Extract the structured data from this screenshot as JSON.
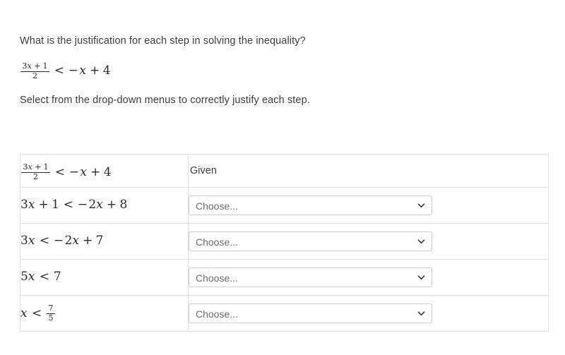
{
  "prompt": {
    "question": "What is the justification for each step in solving the inequality?",
    "inequality": {
      "fraction_numerator": "3x+1",
      "fraction_denominator": "2",
      "relation": "<",
      "right_side": "−x + 4"
    },
    "instruction": "Select from the drop-down menus to correctly justify each step."
  },
  "table": {
    "rows": [
      {
        "step_text": "(3x+1)/2 < −x + 4",
        "justification_type": "static",
        "justification_label": "Given"
      },
      {
        "step_text": "3x + 1 < −2x + 8",
        "justification_type": "select",
        "justification_label": "Choose..."
      },
      {
        "step_text": "3x < −2x + 7",
        "justification_type": "select",
        "justification_label": "Choose..."
      },
      {
        "step_text": "5x < 7",
        "justification_type": "select",
        "justification_label": "Choose..."
      },
      {
        "step_text": "x < 7/5",
        "justification_type": "select",
        "justification_label": "Choose..."
      }
    ]
  },
  "math_tokens": {
    "three": "3",
    "one": "1",
    "two": "2",
    "four": "4",
    "five": "5",
    "seven": "7",
    "eight": "8",
    "x": "x",
    "lt": "<",
    "plus": "+",
    "minus": "−"
  },
  "icons": {
    "chevron_down": "chevron-down-icon"
  },
  "colors": {
    "page_background": "#ffffff",
    "text": "#3d3d3d",
    "math_text": "#2b2b2b",
    "table_border": "#e2e2e2",
    "select_border": "#c9c9c9",
    "placeholder_text": "#6c6c6c",
    "chevron": "#333333"
  }
}
